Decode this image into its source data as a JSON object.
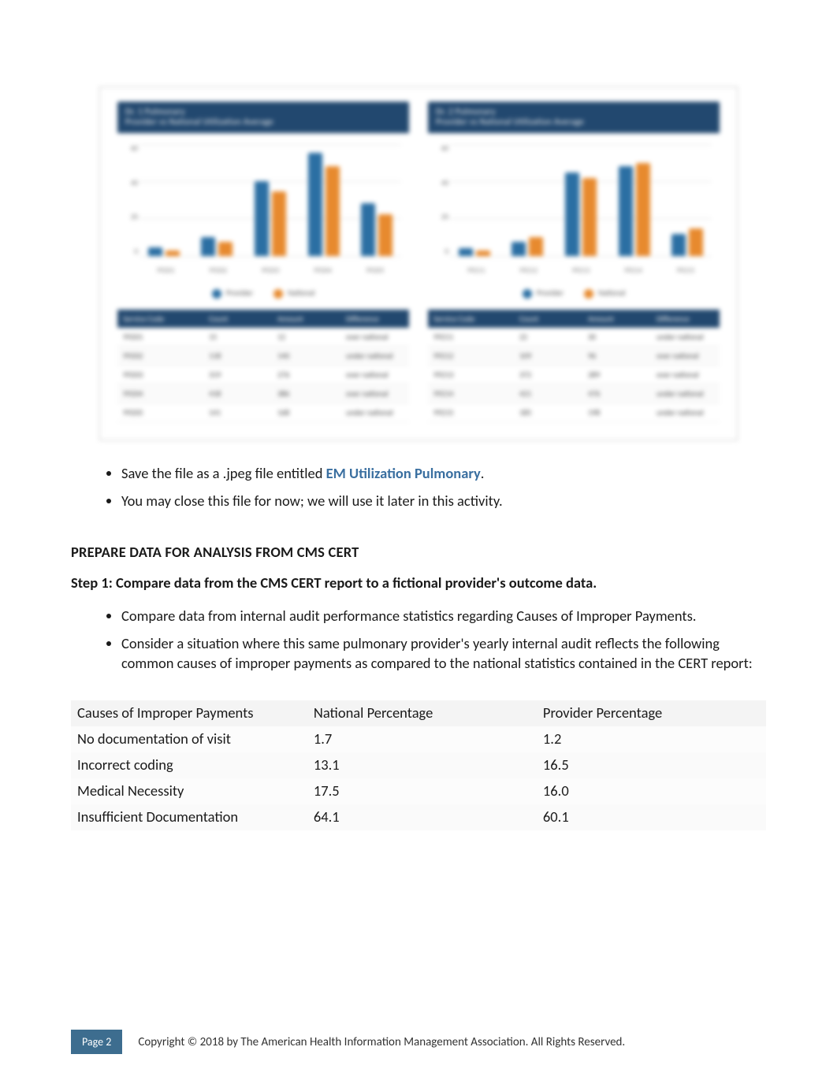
{
  "figure": {
    "left": {
      "title_line1": "Dr. 1 Pulmonary",
      "title_line2": "Provider vs National Utilization Average",
      "legend_series1": "Provider",
      "legend_series2": "National",
      "table_headers": [
        "Service Code",
        "Count",
        "Amount",
        "Difference"
      ],
      "table_rows": [
        [
          "99201",
          "15",
          "12",
          "over national"
        ],
        [
          "99202",
          "118",
          "140",
          "under national"
        ],
        [
          "99203",
          "319",
          "276",
          "over national"
        ],
        [
          "99204",
          "418",
          "386",
          "over national"
        ],
        [
          "99205",
          "141",
          "168",
          "under national"
        ]
      ]
    },
    "right": {
      "title_line1": "Dr. 2 Pulmonary",
      "title_line2": "Provider vs National Utilization Average",
      "legend_series1": "Provider",
      "legend_series2": "National",
      "table_headers": [
        "Service Code",
        "Count",
        "Amount",
        "Difference"
      ],
      "table_rows": [
        [
          "99211",
          "22",
          "30",
          "under national"
        ],
        [
          "99212",
          "109",
          "96",
          "over national"
        ],
        [
          "99213",
          "372",
          "289",
          "over national"
        ],
        [
          "99214",
          "421",
          "476",
          "under national"
        ],
        [
          "99215",
          "185",
          "198",
          "under national"
        ]
      ]
    }
  },
  "bullets_top": {
    "item1_prefix": "Save the file as a .jpeg file entitled ",
    "item1_highlight": "EM Utilization Pulmonary",
    "item1_suffix": ".",
    "item2": "You may close this file for now; we will use it later in this activity."
  },
  "section_heading": "PREPARE DATA FOR ANALYSIS FROM CMS CERT",
  "step_line": "Step 1: Compare data from the CMS CERT report to a fictional provider's outcome data.",
  "step_bullets": {
    "b1": "Compare data from internal audit performance statistics regarding Causes of Improper Payments.",
    "b2": "Consider a situation where this same pulmonary provider's yearly internal audit reflects the following common causes of improper payments as compared to the national statistics contained in the CERT report:"
  },
  "causes_table": {
    "headers": [
      "Causes of Improper Payments",
      "National Percentage",
      "Provider Percentage"
    ],
    "rows": [
      [
        "No documentation of visit",
        "1.7",
        "1.2"
      ],
      [
        "Incorrect coding",
        "13.1",
        "16.5"
      ],
      [
        "Medical Necessity",
        "17.5",
        "16.0"
      ],
      [
        "Insufficient Documentation",
        "64.1",
        "60.1"
      ]
    ]
  },
  "footer": {
    "page_label": "Page 2",
    "copyright": "Copyright © 2018 by The American Health Information Management Association. All Rights Reserved."
  },
  "chart_data": [
    {
      "type": "bar",
      "title": "Dr. 1 Pulmonary — Provider vs National Utilization Average",
      "categories": [
        "99201",
        "99202",
        "99203",
        "99204",
        "99205"
      ],
      "series": [
        {
          "name": "Provider",
          "values": [
            5,
            10,
            40,
            55,
            28
          ]
        },
        {
          "name": "National",
          "values": [
            3,
            8,
            35,
            48,
            22
          ]
        }
      ],
      "ylabel": "%",
      "ylim": [
        0,
        60
      ]
    },
    {
      "type": "bar",
      "title": "Dr. 2 Pulmonary — Provider vs National Utilization Average",
      "categories": [
        "99211",
        "99212",
        "99213",
        "99214",
        "99215"
      ],
      "series": [
        {
          "name": "Provider",
          "values": [
            4,
            8,
            45,
            48,
            12
          ]
        },
        {
          "name": "National",
          "values": [
            3,
            10,
            42,
            50,
            15
          ]
        }
      ],
      "ylabel": "%",
      "ylim": [
        0,
        60
      ]
    },
    {
      "type": "table",
      "title": "Causes of Improper Payments",
      "categories": [
        "No documentation of visit",
        "Incorrect coding",
        "Medical Necessity",
        "Insufficient Documentation"
      ],
      "series": [
        {
          "name": "National Percentage",
          "values": [
            1.7,
            13.1,
            17.5,
            64.1
          ]
        },
        {
          "name": "Provider Percentage",
          "values": [
            1.2,
            16.5,
            16.0,
            60.1
          ]
        }
      ],
      "ylabel": "Percentage"
    }
  ]
}
